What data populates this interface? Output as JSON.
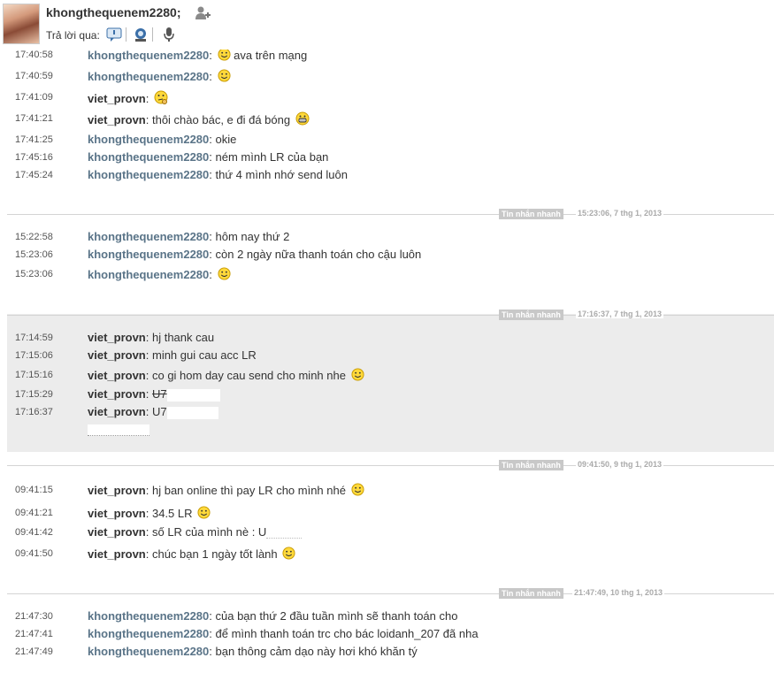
{
  "header": {
    "contact_name": "khongthequenem2280;",
    "reply_label": "Trả lời qua:"
  },
  "sections": [
    {
      "messages": [
        {
          "time": "17:40:58",
          "sender": "khongthequenem2280",
          "text": "ava trên mạng",
          "emoticon": "smile"
        },
        {
          "time": "17:40:59",
          "sender": "khongthequenem2280",
          "text": "",
          "emoticon": "smile"
        },
        {
          "time": "17:41:09",
          "sender": "viet_provn",
          "text": "",
          "emoticon": "thinking"
        },
        {
          "time": "17:41:21",
          "sender": "viet_provn",
          "text": "thôi chào bác, e đi đá bóng",
          "emoticon": "grin"
        },
        {
          "time": "17:41:25",
          "sender": "khongthequenem2280",
          "text": "okie"
        },
        {
          "time": "17:45:16",
          "sender": "khongthequenem2280",
          "text": "ném mình LR của bạn"
        },
        {
          "time": "17:45:24",
          "sender": "khongthequenem2280",
          "text": "thứ 4 mình nhớ send luôn"
        }
      ]
    },
    {
      "divider": {
        "badge": "Tin nhắn nhanh",
        "stamp": "15:23:06, 7 thg 1, 2013"
      },
      "messages": [
        {
          "time": "15:22:58",
          "sender": "khongthequenem2280",
          "text": "hôm nay thứ 2"
        },
        {
          "time": "15:23:06",
          "sender": "khongthequenem2280",
          "text": "còn 2 ngày nữa thanh toán cho cậu luôn"
        },
        {
          "time": "15:23:06",
          "sender": "khongthequenem2280",
          "text": "",
          "emoticon": "smile"
        }
      ]
    },
    {
      "divider": {
        "badge": "Tin nhắn nhanh",
        "stamp": "17:16:37, 7 thg 1, 2013"
      },
      "messages": [
        {
          "time": "17:14:59",
          "sender": "viet_provn",
          "text": "hj thank cau"
        },
        {
          "time": "17:15:06",
          "sender": "viet_provn",
          "text": "minh gui cau acc LR"
        },
        {
          "time": "17:15:16",
          "sender": "viet_provn",
          "text": "co gi hom day cau send cho minh nhe",
          "emoticon": "smile"
        },
        {
          "time": "17:15:29",
          "sender": "viet_provn",
          "text": "U7"
        },
        {
          "time": "17:16:37",
          "sender": "viet_provn",
          "text": "U7"
        }
      ]
    },
    {
      "divider": {
        "badge": "Tin nhắn nhanh",
        "stamp": "09:41:50, 9 thg 1, 2013"
      },
      "messages": [
        {
          "time": "09:41:15",
          "sender": "viet_provn",
          "text": "hj ban online thì pay LR cho mình nhé",
          "emoticon": "smile"
        },
        {
          "time": "09:41:21",
          "sender": "viet_provn",
          "text": "34.5 LR",
          "emoticon": "smile"
        },
        {
          "time": "09:41:42",
          "sender": "viet_provn",
          "text": "số LR của mình nè : U"
        },
        {
          "time": "09:41:50",
          "sender": "viet_provn",
          "text": "chúc bạn 1 ngày tốt lành",
          "emoticon": "smile"
        }
      ]
    },
    {
      "divider": {
        "badge": "Tin nhắn nhanh",
        "stamp": "21:47:49, 10 thg 1, 2013"
      },
      "messages": [
        {
          "time": "21:47:30",
          "sender": "khongthequenem2280",
          "text": "của bạn thứ 2 đầu tuần mình sẽ thanh toán cho"
        },
        {
          "time": "21:47:41",
          "sender": "khongthequenem2280",
          "text": "để mình thanh toán trc cho bác loidanh_207 đã nha"
        },
        {
          "time": "21:47:49",
          "sender": "khongthequenem2280",
          "text": "bạn thông cảm dạo này hơi khó khăn tý"
        }
      ]
    }
  ]
}
